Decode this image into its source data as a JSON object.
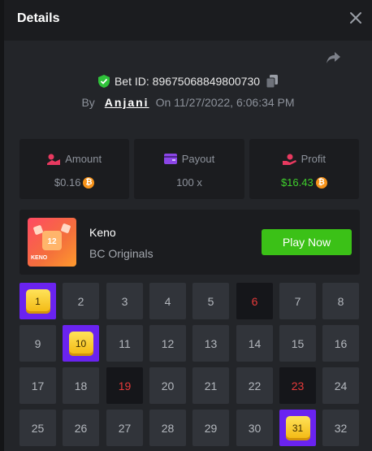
{
  "header": {
    "title": "Details"
  },
  "bet": {
    "id_text": "Bet ID: 89675068849800730"
  },
  "byline": {
    "by_label": "By",
    "user": "Anjani",
    "on_label": "On",
    "datetime": "11/27/2022, 6:06:34 PM"
  },
  "stats": {
    "amount": {
      "label": "Amount",
      "value": "$0.16"
    },
    "payout": {
      "label": "Payout",
      "value": "100 x"
    },
    "profit": {
      "label": "Profit",
      "value": "$16.43"
    }
  },
  "game": {
    "thumb_number": "12",
    "thumb_label": "KENO",
    "name": "Keno",
    "provider": "BC Originals",
    "play_label": "Play Now"
  },
  "colors": {
    "accent_green": "#3bc117",
    "hit_purple": "#6a23f0",
    "miss_red": "#e73a3a",
    "coin": "#f7931a"
  },
  "keno": {
    "cells": [
      {
        "n": "1",
        "state": "hit"
      },
      {
        "n": "2",
        "state": "normal"
      },
      {
        "n": "3",
        "state": "normal"
      },
      {
        "n": "4",
        "state": "normal"
      },
      {
        "n": "5",
        "state": "normal"
      },
      {
        "n": "6",
        "state": "miss"
      },
      {
        "n": "7",
        "state": "normal"
      },
      {
        "n": "8",
        "state": "normal"
      },
      {
        "n": "9",
        "state": "normal"
      },
      {
        "n": "10",
        "state": "hit"
      },
      {
        "n": "11",
        "state": "normal"
      },
      {
        "n": "12",
        "state": "normal"
      },
      {
        "n": "13",
        "state": "normal"
      },
      {
        "n": "14",
        "state": "normal"
      },
      {
        "n": "15",
        "state": "normal"
      },
      {
        "n": "16",
        "state": "normal"
      },
      {
        "n": "17",
        "state": "normal"
      },
      {
        "n": "18",
        "state": "normal"
      },
      {
        "n": "19",
        "state": "miss"
      },
      {
        "n": "20",
        "state": "normal"
      },
      {
        "n": "21",
        "state": "normal"
      },
      {
        "n": "22",
        "state": "normal"
      },
      {
        "n": "23",
        "state": "miss"
      },
      {
        "n": "24",
        "state": "normal"
      },
      {
        "n": "25",
        "state": "normal"
      },
      {
        "n": "26",
        "state": "normal"
      },
      {
        "n": "27",
        "state": "normal"
      },
      {
        "n": "28",
        "state": "normal"
      },
      {
        "n": "29",
        "state": "normal"
      },
      {
        "n": "30",
        "state": "normal"
      },
      {
        "n": "31",
        "state": "hit"
      },
      {
        "n": "32",
        "state": "normal"
      }
    ]
  }
}
